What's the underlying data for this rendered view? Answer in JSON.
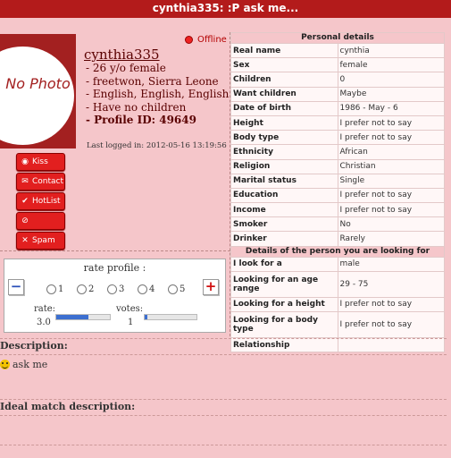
{
  "window": {
    "title": "cynthia335: :P ask me..."
  },
  "photo": {
    "text": "No Photo"
  },
  "actions": [
    {
      "label": "Kiss",
      "icon": "kiss-icon"
    },
    {
      "label": "Contact",
      "icon": "envelope-icon"
    },
    {
      "label": "HotList",
      "icon": "checkmark-icon"
    },
    {
      "label": "BlockList",
      "icon": "block-icon"
    },
    {
      "label": "Spam",
      "icon": "x-icon"
    }
  ],
  "profile": {
    "status": "Offline",
    "username": "cynthia335",
    "lines": [
      "- 26 y/o female",
      "- freetwon, Sierra Leone",
      "- English, English, English",
      "- Have no children"
    ],
    "profile_id": "- Profile ID: 49649",
    "last_logged": "Last logged in: 2012-05-16 13:19:56"
  },
  "personal_details": {
    "header": "Personal details",
    "rows": [
      {
        "k": "Real name",
        "v": "cynthia"
      },
      {
        "k": "Sex",
        "v": "female"
      },
      {
        "k": "Children",
        "v": "0"
      },
      {
        "k": "Want children",
        "v": "Maybe"
      },
      {
        "k": "Date of birth",
        "v": "1986 - May - 6"
      },
      {
        "k": "Height",
        "v": "I prefer not to say"
      },
      {
        "k": "Body type",
        "v": "I prefer not to say"
      },
      {
        "k": "Ethnicity",
        "v": "African"
      },
      {
        "k": "Religion",
        "v": "Christian"
      },
      {
        "k": "Marital status",
        "v": "Single"
      },
      {
        "k": "Education",
        "v": "I prefer not to say"
      },
      {
        "k": "Income",
        "v": "I prefer not to say"
      },
      {
        "k": "Smoker",
        "v": "No"
      },
      {
        "k": "Drinker",
        "v": "Rarely"
      }
    ]
  },
  "looking_for": {
    "header": "Details of the person you are looking for",
    "rows": [
      {
        "k": "I look for a",
        "v": "male"
      },
      {
        "k": "Looking for an age range",
        "v": "29 - 75"
      },
      {
        "k": "Looking for a height",
        "v": "I prefer not to say"
      },
      {
        "k": "Looking for a body type",
        "v": "I prefer not to say"
      },
      {
        "k": "Relationship",
        "v": ""
      }
    ]
  },
  "rating": {
    "title": "rate profile :",
    "minus": "−",
    "plus": "+",
    "options": [
      "1",
      "2",
      "3",
      "4",
      "5"
    ],
    "rate_label": "rate:",
    "rate_value": "3.0",
    "rate_fraction": 0.6,
    "votes_label": "votes:",
    "votes_value": "1",
    "votes_fraction": 0.05
  },
  "description": {
    "header": "Description:",
    "text": "ask me"
  },
  "ideal_match": {
    "header": "Ideal match description:"
  }
}
